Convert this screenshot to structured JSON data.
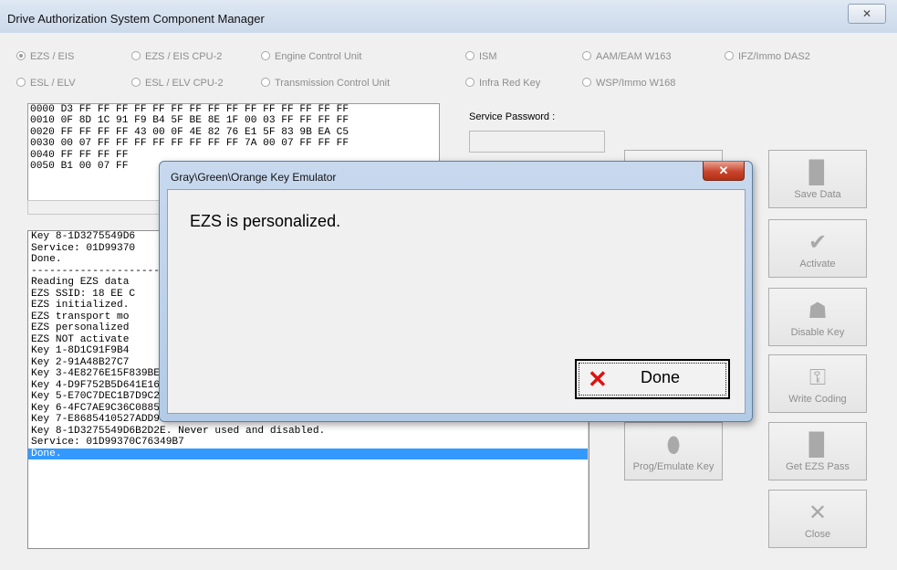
{
  "window": {
    "title": "Drive Authorization System Component Manager",
    "close_glyph": "✕"
  },
  "radios": {
    "row1": [
      "EZS / EIS",
      "EZS / EIS CPU-2",
      "Engine Control Unit",
      "ISM",
      "AAM/EAM W163",
      "IFZ/Immo DAS2"
    ],
    "row2": [
      "ESL / ELV",
      "ESL / ELV CPU-2",
      "Transmission Control Unit",
      "Infra Red Key",
      "WSP/Immo W168"
    ],
    "selected": "EZS / EIS"
  },
  "hex_lines": [
    "0000 D3 FF FF FF FF FF FF FF FF FF FF FF FF FF FF FF",
    "0010 0F 8D 1C 91 F9 B4 5F BE 8E 1F 00 03 FF FF FF FF",
    "0020 FF FF FF FF 43 00 0F 4E 82 76 E1 5F 83 9B EA C5",
    "0030 00 07 FF FF FF FF FF FF FF FF 7A 00 07 FF FF FF",
    "0040 FF FF FF FF",
    "0050 B1 00 07 FF"
  ],
  "service_password_label": "Service Password :",
  "log_lines": [
    "Key 8-1D3275549D6",
    "Service: 01D99370",
    "Done.",
    "-------------------------------",
    "Reading EZS data",
    "EZS SSID: 18 EE C",
    "EZS initialized.",
    "EZS transport mo",
    "EZS personalized",
    "EZS NOT activate",
    "Key 1-8D1C91F9B4",
    "Key 2-91A48B27C7",
    "Key 3-4E8276E15F839BEA. Never used and disabled.",
    "Key 4-D9F752B5D641E166. Never used and disabled.",
    "Key 5-E70C7DEC1B7D9C20. Never used and disabled.",
    "Key 6-4FC7AE9C36C08854. Never used and disabled.",
    "Key 7-E8685410527ADD94. Never used and disabled.",
    "Key 8-1D3275549D6B2D2E. Never used and disabled.",
    "Service: 01D99370C76349B7",
    "Done."
  ],
  "buttons": {
    "save_data": "Save Data",
    "activate": "Activate",
    "disable_key": "Disable Key",
    "write_coding": "Write Coding",
    "prog_emulate_key": "Prog/Emulate Key",
    "get_ezs_pass": "Get EZS Pass",
    "close": "Close"
  },
  "dialog": {
    "title": "Gray\\Green\\Orange Key Emulator",
    "message": "EZS is personalized.",
    "done_label": "Done",
    "close_glyph": "✕"
  }
}
